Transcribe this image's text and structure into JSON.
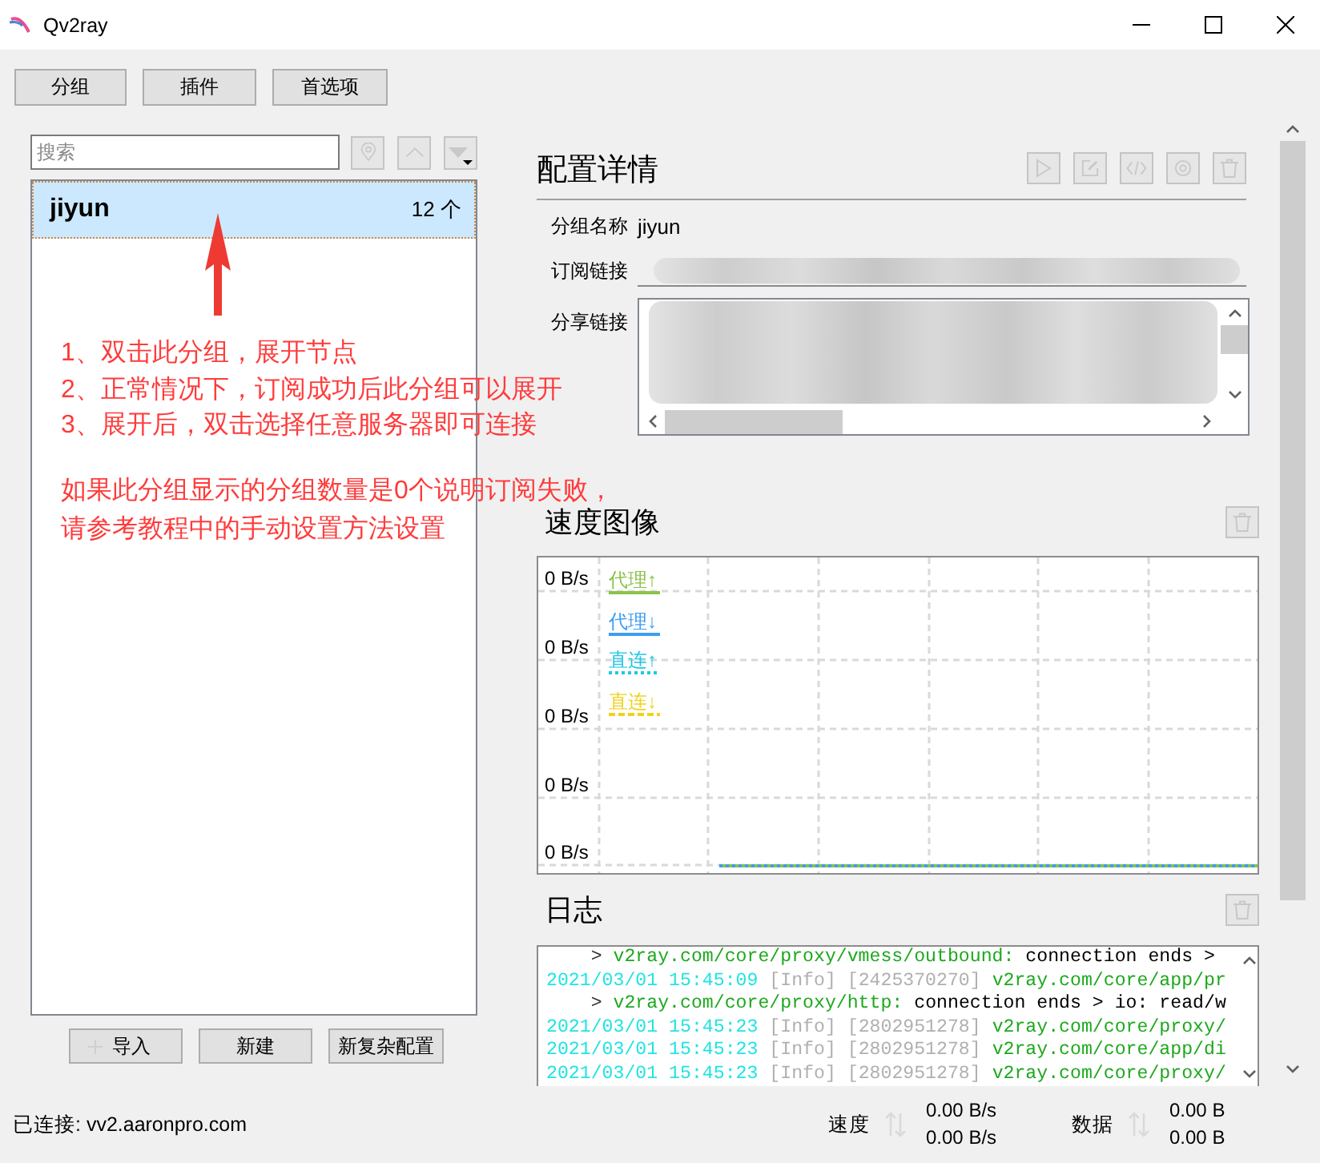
{
  "window": {
    "title": "Qv2ray"
  },
  "toolbar": {
    "buttons": [
      "分组",
      "插件",
      "首选项"
    ]
  },
  "group_list": {
    "search": {
      "placeholder": "搜索"
    },
    "tools": {
      "disabled": true
    },
    "items": [
      {
        "name": "jiyun",
        "count": "12 个",
        "selected": true
      }
    ],
    "buttons": [
      "导入",
      "新建",
      "新复杂配置"
    ]
  },
  "annotation": {
    "steps": [
      "1、双击此分组，展开节点",
      "2、正常情况下，订阅成功后此分组可以展开",
      "3、展开后，双击选择任意服务器即可连接"
    ],
    "note": [
      "如果此分组显示的分组数量是0个说明订阅失败，",
      "请参考教程中的手动设置方法设置"
    ]
  },
  "details": {
    "title": "配置详情",
    "actions": {
      "disabled": true
    },
    "fields": [
      {
        "label": "分组名称",
        "kind": "text",
        "value": "jiyun"
      },
      {
        "label": "订阅链接",
        "kind": "line"
      },
      {
        "label": "分享链接",
        "kind": "area"
      }
    ]
  },
  "speed_chart": {
    "title": "速度图像",
    "clear": {
      "disabled": true
    },
    "y_labels": [
      "0 B/s",
      "0 B/s",
      "0 B/s",
      "0 B/s",
      "0 B/s"
    ],
    "legend": [
      {
        "label": "代理↑",
        "color": "#8bc34a",
        "kind": "solid"
      },
      {
        "label": "代理↓",
        "color": "#3d9df2",
        "kind": "solid"
      },
      {
        "label": "直连↑",
        "color": "#1ec8e8",
        "kind": "dotted"
      },
      {
        "label": "直连↓",
        "color": "#f0d21e",
        "kind": "dashed"
      }
    ]
  },
  "log": {
    "title": "日志",
    "clear": {
      "disabled": true
    },
    "lines": [
      {
        "kind": "continuation",
        "marker": ">",
        "module": "v2ray.com/core/proxy/vmess/outbound:",
        "message": "connection ends >"
      },
      {
        "kind": "entry",
        "time": "2021/03/01 15:45:09",
        "level": "[Info]",
        "thread": "[2425370270]",
        "module": "v2ray.com/core/app/pr"
      },
      {
        "kind": "continuation",
        "marker": ">",
        "module": "v2ray.com/core/proxy/http:",
        "message": "connection ends > io: read/w"
      },
      {
        "kind": "entry",
        "time": "2021/03/01 15:45:23",
        "level": "[Info]",
        "thread": "[2802951278]",
        "module": "v2ray.com/core/proxy/"
      },
      {
        "kind": "entry",
        "time": "2021/03/01 15:45:23",
        "level": "[Info]",
        "thread": "[2802951278]",
        "module": "v2ray.com/core/app/di"
      },
      {
        "kind": "entry",
        "time": "2021/03/01 15:45:23",
        "level": "[Info]",
        "thread": "[2802951278]",
        "module": "v2ray.com/core/proxy/"
      }
    ]
  },
  "status_bar": {
    "connection": "已连接: vv2.aaronpro.com",
    "speed": {
      "label": "速度",
      "values": [
        "0.00 B/s",
        "0.00 B/s"
      ]
    },
    "data": {
      "label": "数据",
      "values": [
        "0.00 B",
        "0.00 B"
      ]
    }
  }
}
